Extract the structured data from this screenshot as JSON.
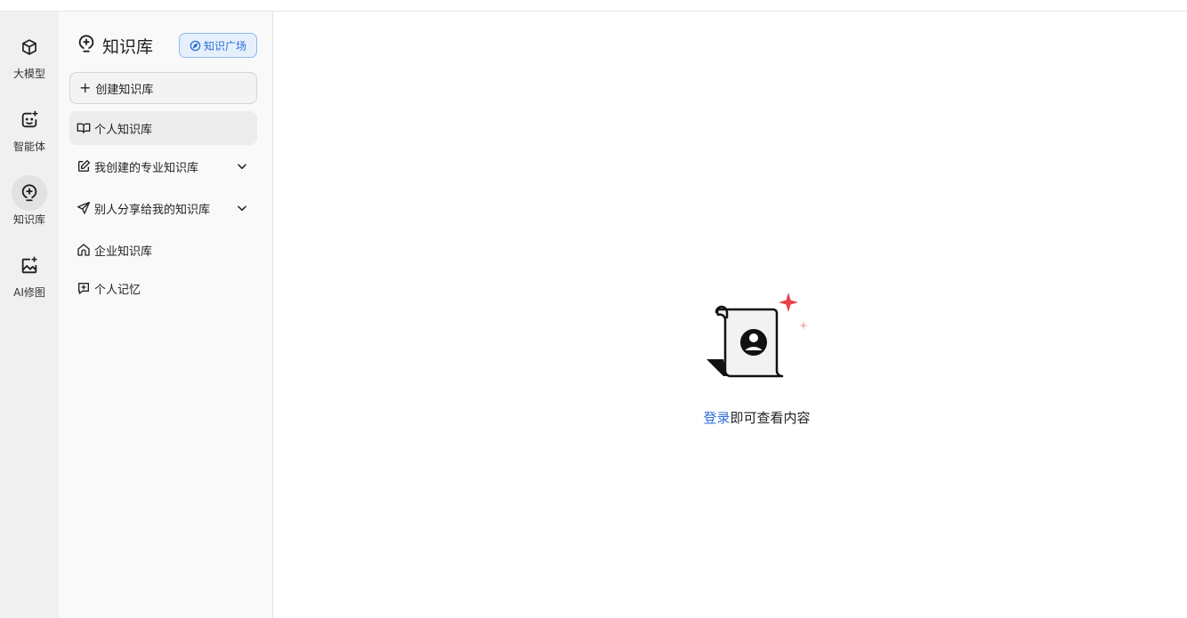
{
  "rail": {
    "items": [
      {
        "label": "大模型",
        "icon": "cube-icon"
      },
      {
        "label": "智能体",
        "icon": "agent-face-icon"
      },
      {
        "label": "知识库",
        "icon": "lightbulb-icon",
        "active": true
      },
      {
        "label": "AI修图",
        "icon": "image-sparkle-icon"
      }
    ]
  },
  "panel": {
    "title": "知识库",
    "plaza_label": "知识广场",
    "create_label": "创建知识库",
    "nav": [
      {
        "label": "个人知识库",
        "icon": "book-icon",
        "active": true
      },
      {
        "label": "我创建的专业知识库",
        "icon": "edit-icon",
        "expandable": true
      },
      {
        "label": "别人分享给我的知识库",
        "icon": "send-icon",
        "expandable": true
      },
      {
        "label": "企业知识库",
        "icon": "home-icon"
      },
      {
        "label": "个人记忆",
        "icon": "memory-icon"
      }
    ]
  },
  "empty": {
    "login_link": "登录",
    "message": "即可查看内容"
  },
  "colors": {
    "accent": "#2d6fd6",
    "sparkle": "#e8414b"
  }
}
